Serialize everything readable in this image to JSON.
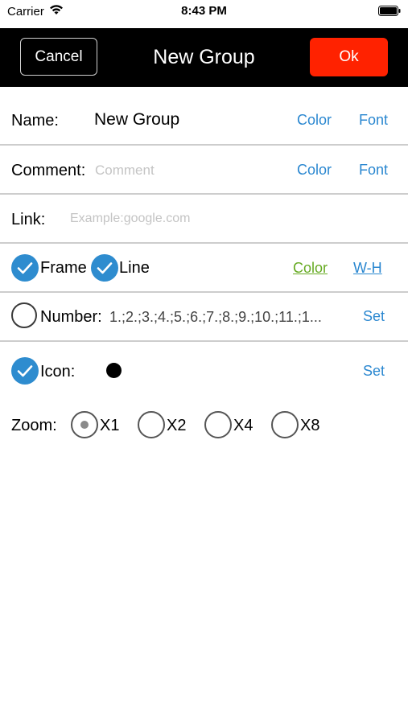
{
  "status_bar": {
    "carrier": "Carrier",
    "time": "8:43 PM"
  },
  "nav": {
    "cancel_label": "Cancel",
    "title": "New Group",
    "ok_label": "Ok"
  },
  "name_row": {
    "label": "Name:",
    "value": "New Group",
    "color_label": "Color",
    "font_label": "Font"
  },
  "comment_row": {
    "label": "Comment:",
    "placeholder": "Comment",
    "color_label": "Color",
    "font_label": "Font"
  },
  "link_row": {
    "label": "Link:",
    "placeholder": "Example:google.com"
  },
  "frame_row": {
    "frame_label": "Frame",
    "line_label": "Line",
    "color_label": "Color",
    "wh_label": "W-H",
    "frame_checked": true,
    "line_checked": true
  },
  "number_row": {
    "label": "Number:",
    "value": "1.;2.;3.;4.;5.;6.;7.;8.;9.;10.;11.;1...",
    "set_label": "Set",
    "checked": false
  },
  "icon_row": {
    "label": "Icon:",
    "set_label": "Set",
    "checked": true
  },
  "zoom_row": {
    "label": "Zoom:",
    "options": [
      "X1",
      "X2",
      "X4",
      "X8"
    ],
    "selected": "X1"
  },
  "colors": {
    "accent": "#2a87d0",
    "ok": "#ff2200",
    "check": "#2e8ccf",
    "green_link": "#66aa22"
  }
}
